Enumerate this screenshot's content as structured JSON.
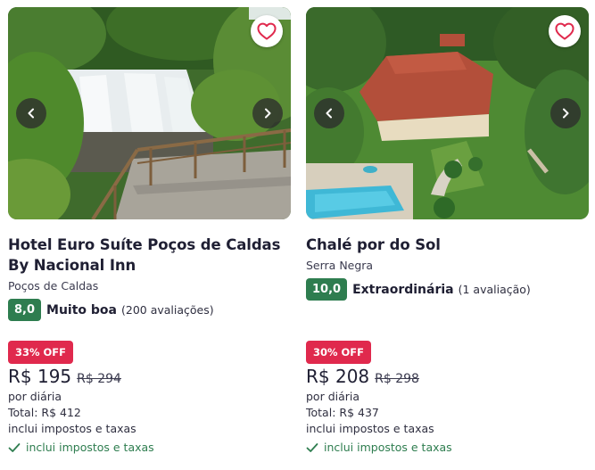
{
  "hotels": [
    {
      "name": "Hotel Euro Suíte Poços de Caldas By Nacional Inn",
      "city": "Poços de Caldas",
      "score": "8,0",
      "rating_label": "Muito boa",
      "rating_count": "(200 avaliações)",
      "discount": "33% OFF",
      "price": "R$ 195",
      "old_price": "R$ 294",
      "per_night": "por diária",
      "total": "Total: R$ 412",
      "taxes_note": "inclui impostos e taxas",
      "included": "inclui impostos e taxas"
    },
    {
      "name": "Chalé por do Sol",
      "city": "Serra Negra",
      "score": "10,0",
      "rating_label": "Extraordinária",
      "rating_count": "(1 avaliação)",
      "discount": "30% OFF",
      "price": "R$ 208",
      "old_price": "R$ 298",
      "per_night": "por diária",
      "total": "Total: R$ 437",
      "taxes_note": "inclui impostos e taxas",
      "included": "inclui impostos e taxas"
    }
  ],
  "colors": {
    "score_green": "#2e7d4f",
    "discount_red": "#e0294d",
    "heart_red": "#e0294d"
  },
  "icons": [
    "heart-icon",
    "chevron-left-icon",
    "chevron-right-icon",
    "check-icon"
  ]
}
